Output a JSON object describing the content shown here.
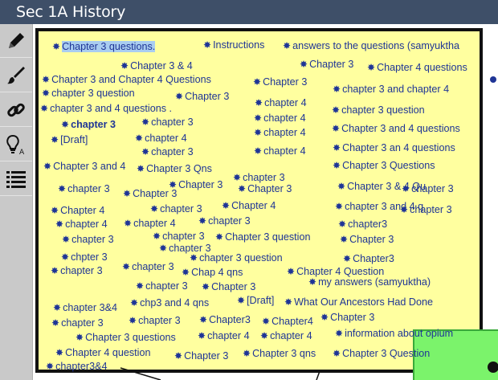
{
  "app": {
    "title": "Sec 1A History"
  },
  "toolbar": {
    "tools": [
      {
        "name": "pencil-icon"
      },
      {
        "name": "brush-icon"
      },
      {
        "name": "link-icon"
      },
      {
        "name": "idea-icon"
      },
      {
        "name": "list-icon"
      }
    ]
  },
  "colors": {
    "board": "#ffff9f",
    "text": "#1f3596",
    "titlebar": "#3e4f68",
    "green_note": "#7bf36b"
  },
  "notes": [
    "Chapter 3 questions.",
    "Instructions",
    "answers to the questions (samyuktha",
    "Chapter 3 & 4",
    "Chapter 3",
    "Chapter 4 questions",
    "Chapter 3 and Chapter 4 Questions",
    "Chapter 3",
    "chapter 3 question",
    "Chapter 3",
    "chapter 3 and chapter 4",
    "chapter 3 and 4 questions .",
    "chapter 4",
    "chapter 3 question",
    "chapter 3",
    "chapter 3",
    "chapter 4",
    "Chapter 3 and 4 questions",
    "[Draft]",
    "chapter 4",
    "chapter 4",
    "Chapter 3 an 4 questions",
    "chapter 3",
    "chapter 4",
    "Chapter 3 and 4",
    "Chapter 3 Qns",
    "Chapter 3 Questions",
    "chapter 3",
    "chapter 3",
    "Chapter 3",
    "Chapter 3",
    "Chapter 3",
    "Chapter 3 & 4 Qu",
    "chapter 3",
    "Chapter 4",
    "chapter 3",
    "Chapter 4",
    "chapter 3 and 4 q",
    "chapter 3",
    "chapter 4",
    "chapter 4",
    "chapter 3",
    "chapter3",
    "chapter 3",
    "chapter 3",
    "Chapter 3 question",
    "Chapter 3",
    "chapter 3",
    "chpter 3",
    "chapter 3",
    "chapter 3 question",
    "Chapter3",
    "chapter 3",
    "Chap 4 qns",
    "Chapter 4 Question",
    "chapter 3",
    "Chapter 3",
    "my answers (samyuktha)",
    "chapter 3&4",
    "chp3 and 4 qns",
    "[Draft]",
    "What Our Ancestors Had Done",
    "chapter 3",
    "chapter 3",
    "Chapter3",
    "Chapter4",
    "Chapter 3",
    "Chapter 3 questions",
    "chapter 4",
    "chapter 4",
    "information about opium",
    "Chapter 4 question",
    "Chapter 3",
    "Chapter 3 qns",
    "Chapter 3 Question",
    "chapter3&4"
  ]
}
